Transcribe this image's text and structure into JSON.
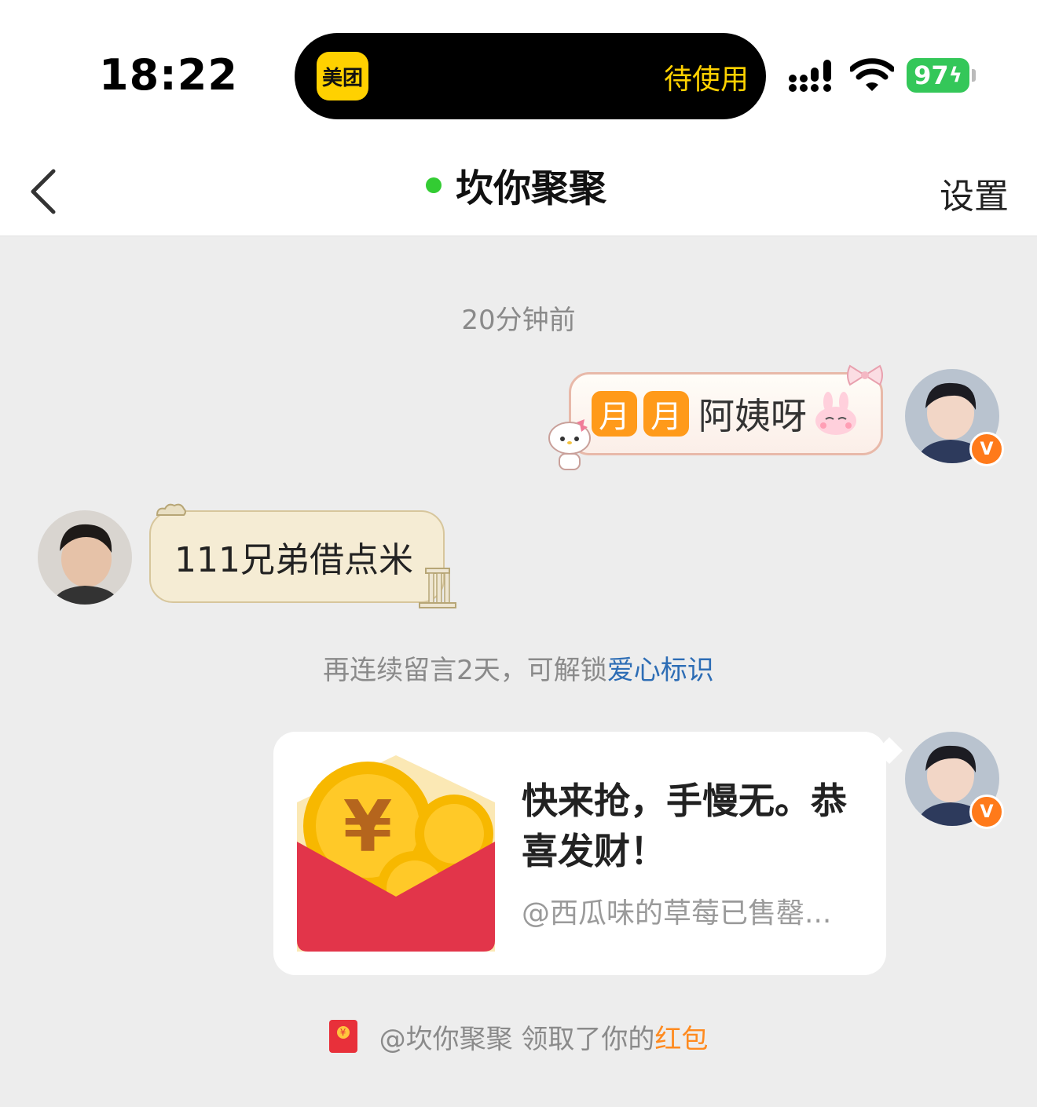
{
  "status_bar": {
    "time": "18:22",
    "app_icon_text": "美团",
    "island_status": "待使用",
    "battery": "97"
  },
  "nav": {
    "title": "坎你聚聚",
    "settings_label": "设置"
  },
  "chat": {
    "timestamp": "20分钟前",
    "msg1": {
      "emoji_1": "月",
      "emoji_2": "月",
      "text": "阿姨呀"
    },
    "msg2": {
      "text": "111兄弟借点米"
    },
    "system_hint": {
      "prefix": "再连续留言2天，可解锁",
      "link": "爱心标识"
    },
    "red_packet": {
      "title": "快来抢，手慢无。恭喜发财！",
      "subtitle": "@西瓜味的草莓已售罄..."
    },
    "notice": {
      "prefix": "@坎你聚聚 领取了你的",
      "highlight": "红包"
    }
  },
  "colors": {
    "accent_yellow": "#ffd100",
    "online_green": "#33cc33",
    "link_blue": "#2d6db5",
    "highlight_orange": "#ff8a1f",
    "packet_red": "#e2354a",
    "battery_green": "#34c759"
  }
}
